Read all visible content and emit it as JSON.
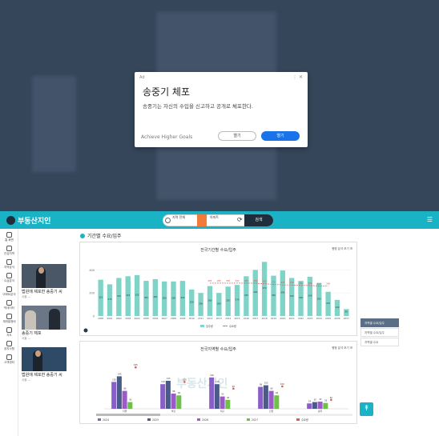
{
  "ad": {
    "tag": "Ad",
    "title": "송중기 체포",
    "description": "송중기는 자신의 수입을 신고하고 공개로 체포한다.",
    "footer": "Achieve Higher Goals",
    "btn_secondary": "열기",
    "btn_primary": "열기"
  },
  "header": {
    "logo": "부동산지인",
    "search_type": "지역 전체",
    "search_region": "아파트",
    "go_label": "검색"
  },
  "sidebar": {
    "items": [
      {
        "label": "홈 화면",
        "icon": "person-icon"
      },
      {
        "label": "관심지역",
        "icon": "map-icon"
      },
      {
        "label": "지역분석",
        "icon": "chart-icon"
      },
      {
        "label": "수급분석",
        "icon": "target-icon"
      },
      {
        "label": "아파트분석",
        "icon": "building-icon"
      },
      {
        "label": "빅데이터",
        "icon": "data-icon"
      },
      {
        "label": "재개발정비",
        "icon": "home-icon"
      },
      {
        "label": "지도",
        "icon": "doc-icon"
      },
      {
        "label": "공지사항",
        "icon": "bell-icon"
      },
      {
        "label": "고객센터",
        "icon": "help-icon"
      }
    ]
  },
  "news": [
    {
      "title": "법원에 제포한 송중기 씨",
      "src": "서울 ---"
    },
    {
      "title": "송중기 체포",
      "src": "서울 ---"
    },
    {
      "title": "법원에 제포한 송중기 씨",
      "src": "서울 ---"
    }
  ],
  "section": {
    "title": "기간별 수요/입주"
  },
  "chart_top": {
    "title": "전국기간별 수요/입주",
    "option": "평형 분석 보기"
  },
  "chart_bottom": {
    "title": "전국지역별 수요/입주",
    "option": "평형 분석 보기"
  },
  "watermark": "부동산지인",
  "side_tabs": [
    "지역별 수요/입주",
    "지역별 수요/입주",
    "지역별 수요"
  ],
  "fab": "↟",
  "chart_data": {
    "type": "bar",
    "title": "전국기간별 수요/입주",
    "categories": [
      "2000",
      "2001",
      "2002",
      "2003",
      "2004",
      "2005",
      "2006",
      "2007",
      "2008",
      "2009",
      "2010",
      "2011",
      "2012",
      "2013",
      "2014",
      "2015",
      "2016",
      "2017",
      "2018",
      "2019",
      "2020",
      "2021",
      "2022",
      "2023",
      "2024",
      "2025",
      "2026",
      "2027"
    ],
    "series": [
      {
        "name": "입주량",
        "values": [
          315,
          275,
          330,
          345,
          355,
          305,
          320,
          300,
          300,
          305,
          230,
          200,
          260,
          200,
          255,
          270,
          345,
          400,
          470,
          350,
          395,
          330,
          305,
          340,
          285,
          210,
          140,
          60
        ]
      },
      {
        "name": "수요량",
        "values": [
          null,
          null,
          null,
          null,
          null,
          null,
          null,
          null,
          null,
          null,
          null,
          null,
          285,
          285,
          285,
          285,
          285,
          285,
          280,
          275,
          270,
          270,
          265,
          265,
          260,
          260,
          null,
          null
        ]
      }
    ],
    "ylim": [
      0,
      500
    ]
  },
  "chart_data_bottom": {
    "type": "bar",
    "title": "전국지역별 수요/입주",
    "groups": [
      "서울",
      "부산",
      "대구",
      "인천",
      "광주"
    ],
    "series": [
      {
        "name": "2024",
        "color": "#8a5ec8",
        "values": [
          120,
          110,
          140,
          98,
          24
        ]
      },
      {
        "name": "2025",
        "color": "#4a5a8a",
        "values": [
          145,
          125,
          110,
          105,
          30
        ]
      },
      {
        "name": "2026",
        "color": "#9a5bc9",
        "values": [
          80,
          68,
          55,
          80,
          32
        ]
      },
      {
        "name": "2027",
        "color": "#6fbf4a",
        "values": [
          30,
          60,
          40,
          60,
          26
        ]
      },
      {
        "name": "수요량",
        "color": "#e05a5a",
        "values": [
          185,
          120,
          90,
          100,
          40
        ]
      }
    ]
  }
}
